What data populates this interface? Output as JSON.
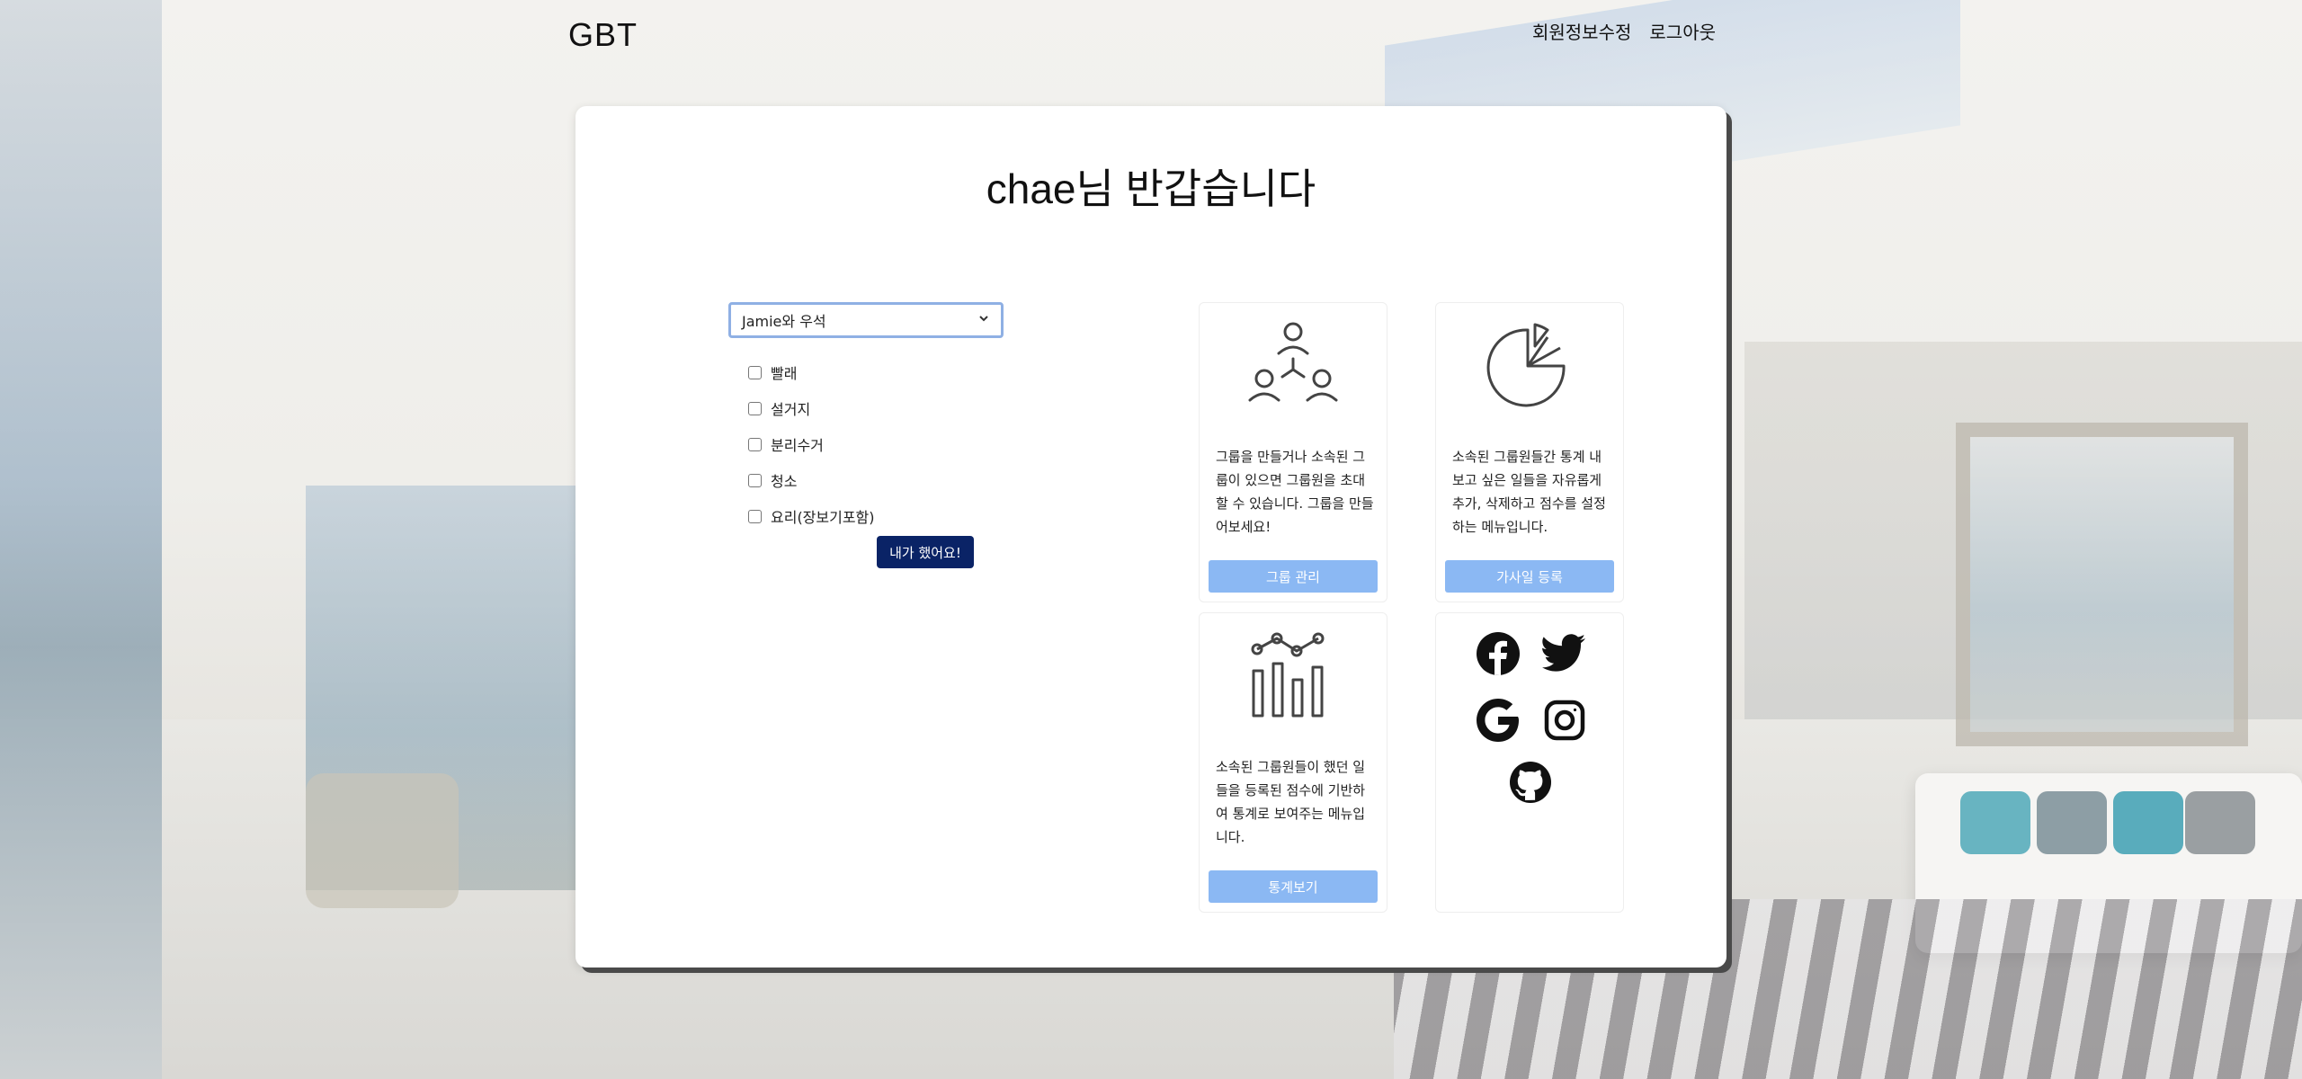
{
  "header": {
    "brand": "GBT",
    "nav": {
      "edit_profile": "회원정보수정",
      "logout": "로그아웃"
    }
  },
  "main": {
    "title": "chae님 반갑습니다",
    "group_select": {
      "value": "Jamie와 우석"
    },
    "tasks": [
      {
        "label": "빨래",
        "checked": false
      },
      {
        "label": "설거지",
        "checked": false
      },
      {
        "label": "분리수거",
        "checked": false
      },
      {
        "label": "청소",
        "checked": false
      },
      {
        "label": "요리(장보기포함)",
        "checked": false
      }
    ],
    "done_button": "내가 했어요!"
  },
  "tiles": {
    "group": {
      "icon": "team-icon",
      "description": "그룹을 만들거나 소속된 그룹이 있으면 그룹원을 초대할 수 있습니다. 그룹을 만들어보세요!",
      "button": "그룹 관리"
    },
    "chores": {
      "icon": "pie-chart-icon",
      "description": "소속된 그룹원들간 통계 내보고 싶은 일들을 자유롭게 추가, 삭제하고 점수를 설정하는 메뉴입니다.",
      "button": "가사일 등록"
    },
    "stats": {
      "icon": "bar-line-chart-icon",
      "description": "소속된 그룹원들이 했던 일들을 등록된 점수에 기반하여 통계로 보여주는 메뉴입니다.",
      "button": "통계보기"
    },
    "social": {
      "icons": [
        "facebook-icon",
        "twitter-icon",
        "google-icon",
        "instagram-icon",
        "github-icon"
      ]
    }
  },
  "colors": {
    "primary_button": "#0a2366",
    "tile_button": "#8bb8f3",
    "select_border": "#8fb0e4"
  }
}
